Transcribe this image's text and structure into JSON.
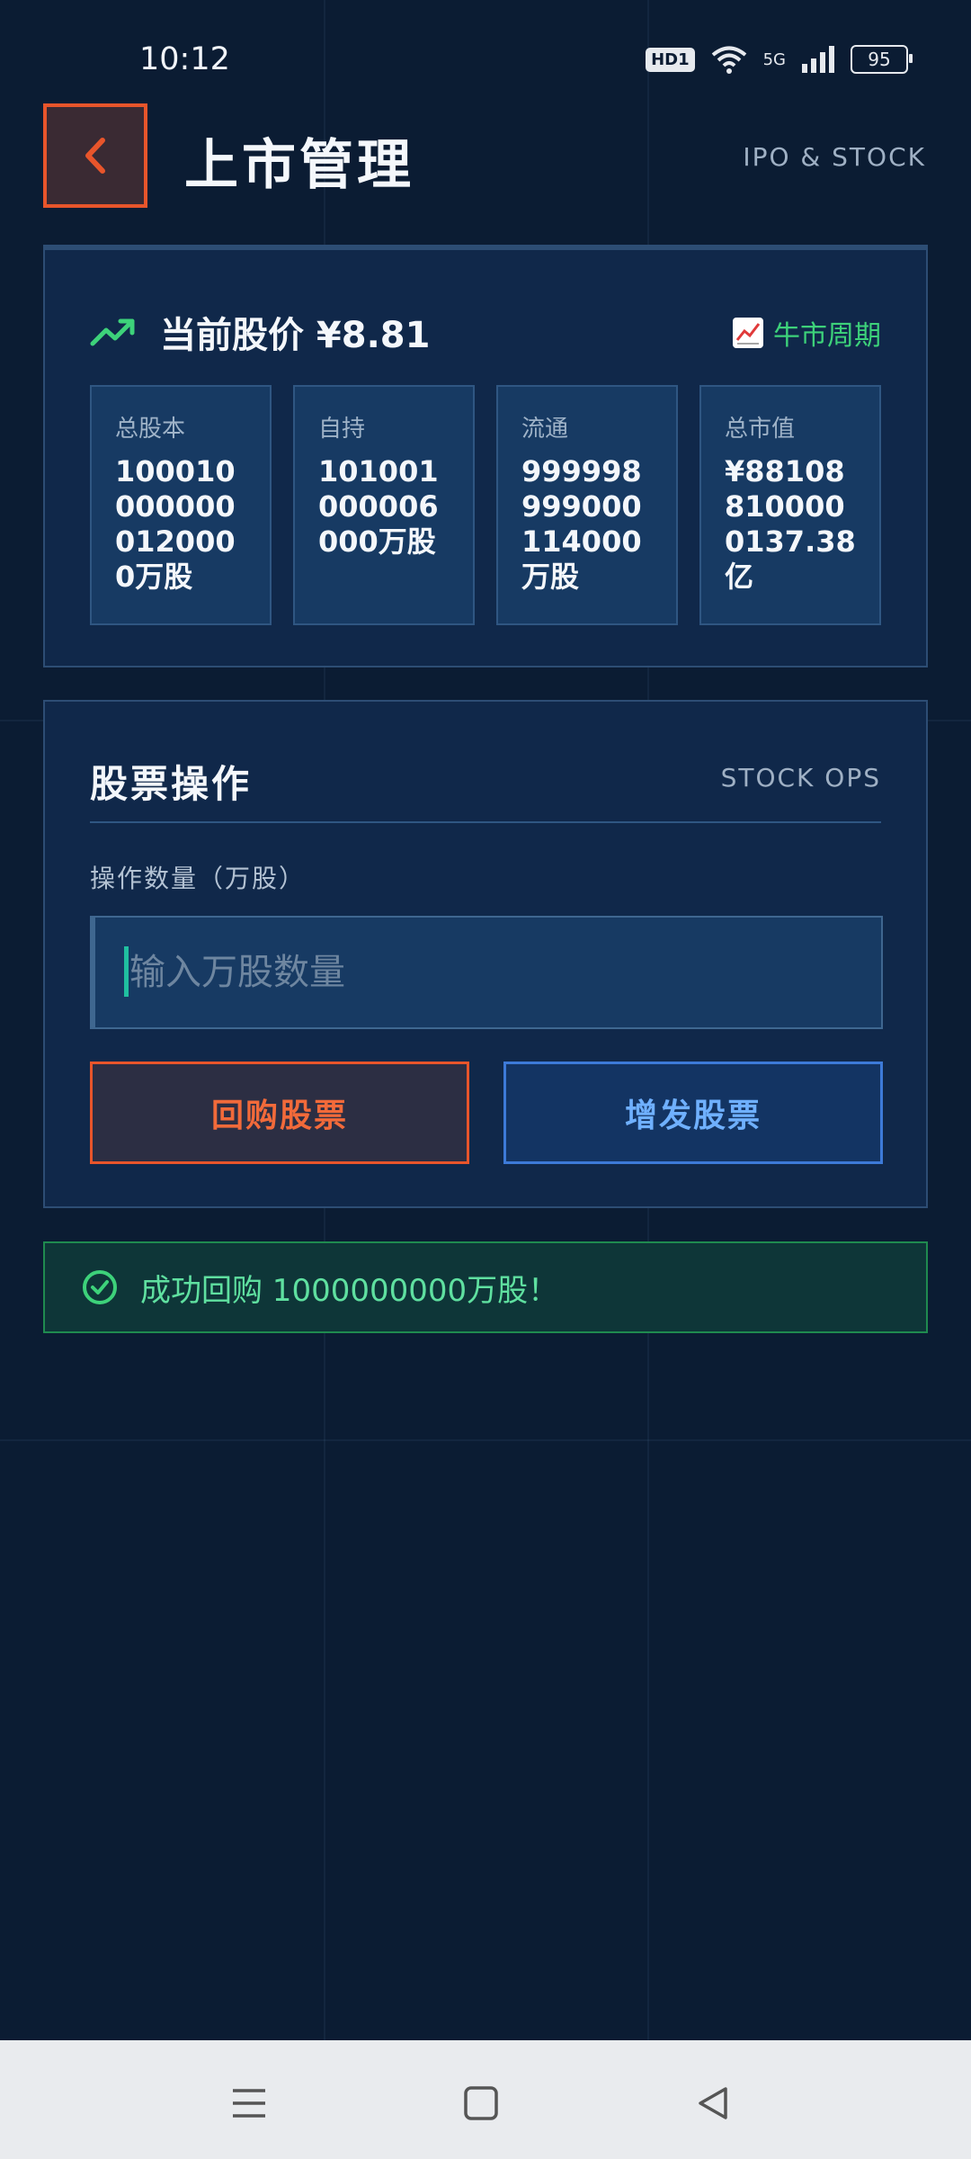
{
  "status_bar": {
    "time": "10:12",
    "hd_badge": "HD1",
    "network": "5G",
    "battery": "95"
  },
  "header": {
    "title": "上市管理",
    "subtitle": "IPO & STOCK"
  },
  "price_card": {
    "price_label": "当前股价 ¥8.81",
    "cycle_label": "牛市周期",
    "stats": [
      {
        "label": "总股本",
        "value": "1000100000000120000万股"
      },
      {
        "label": "自持",
        "value": "101001000006000万股"
      },
      {
        "label": "流通",
        "value": "999998999000114000万股"
      },
      {
        "label": "总市值",
        "value": "¥881088100000137.38亿"
      }
    ]
  },
  "ops_card": {
    "title": "股票操作",
    "subtitle": "STOCK OPS",
    "qty_label": "操作数量（万股）",
    "qty_placeholder": "输入万股数量",
    "qty_value": "",
    "buyback_label": "回购股票",
    "issue_label": "增发股票"
  },
  "toast": {
    "message": "成功回购 1000000000万股！"
  },
  "colors": {
    "background": "#0b1c33",
    "card": "#10284a",
    "accent_red": "#e8552b",
    "accent_blue": "#3d7ad8",
    "success_green": "#3dd27a"
  },
  "icons": {
    "back": "chevron-left-icon",
    "trend": "trending-up-icon",
    "cycle": "chart-increasing-icon",
    "success": "check-circle-icon"
  }
}
